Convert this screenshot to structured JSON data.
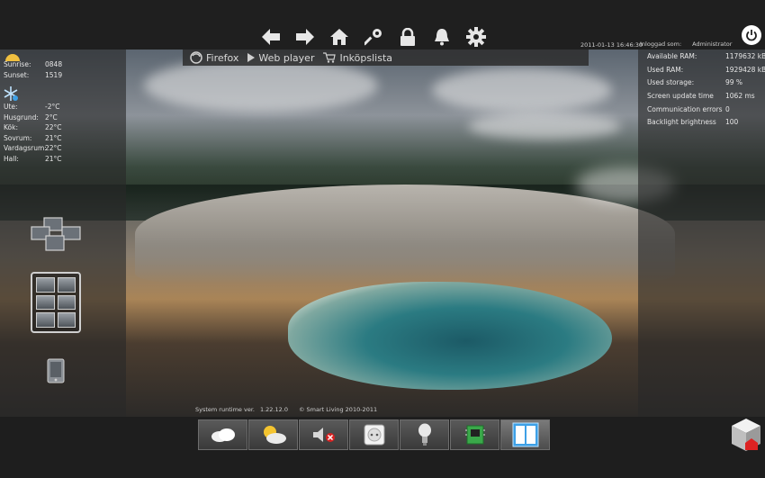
{
  "topbar": {
    "icons": [
      "back-arrow-icon",
      "forward-arrow-icon",
      "home-icon",
      "key-icon",
      "lock-icon",
      "bell-icon",
      "gear-icon"
    ],
    "datetime": "2011-01-13 16:46:30",
    "login_label": "Inloggad som:",
    "login_user": "Administrator",
    "power_icon": "power-icon"
  },
  "bookmarks": [
    {
      "icon": "firefox-icon",
      "label": "Firefox"
    },
    {
      "icon": "play-icon",
      "label": "Web player"
    },
    {
      "icon": "cart-icon",
      "label": "Inköpslista"
    }
  ],
  "weather": {
    "sunrise_label": "Sunrise:",
    "sunrise": "0848",
    "sunset_label": "Sunset:",
    "sunset": "1519",
    "temps": [
      {
        "label": "Ute:",
        "value": "-2°C"
      },
      {
        "label": "Husgrund:",
        "value": "2°C"
      },
      {
        "label": "Kök:",
        "value": "22°C"
      },
      {
        "label": "Sovrum:",
        "value": "21°C"
      },
      {
        "label": "Vardagsrum:",
        "value": "22°C"
      },
      {
        "label": "Hall:",
        "value": "21°C"
      }
    ]
  },
  "stats": [
    {
      "label": "Available RAM:",
      "value": "1179632 kB"
    },
    {
      "label": "Used RAM:",
      "value": "1929428 kB"
    },
    {
      "label": "Used storage:",
      "value": "99 %"
    },
    {
      "label": "Screen update time",
      "value": "1062 ms"
    },
    {
      "label": "Communication errors",
      "value": "0"
    },
    {
      "label": "Backlight brightness",
      "value": "100"
    }
  ],
  "footer": {
    "runtime_label": "System runtime ver.",
    "version": "1.22.12.0",
    "copyright": "© Smart Living 2010-2011"
  },
  "dock": [
    "cloud-icon",
    "weather-icon",
    "mute-speaker-icon",
    "power-outlet-icon",
    "light-bulb-icon",
    "circuit-board-icon",
    "window-icon"
  ],
  "colors": {
    "topbar": "#1f1f1f",
    "panel": "#2a2a2a",
    "accent": "#3da0e6"
  }
}
